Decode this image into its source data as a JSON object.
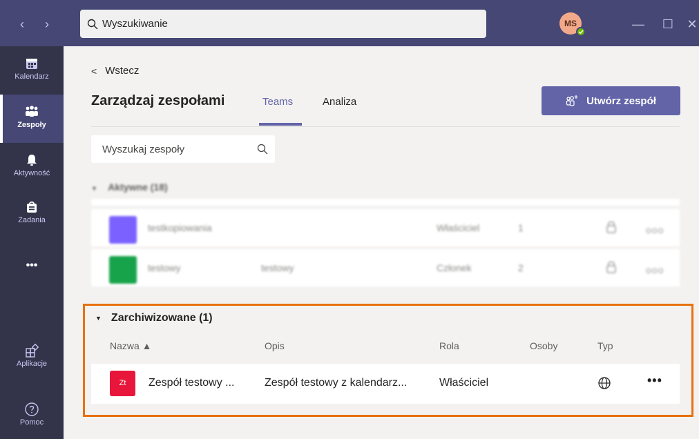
{
  "titlebar": {
    "back_arrow": "‹",
    "forward_arrow": "›",
    "search_placeholder": "Wyszukiwanie",
    "avatar_initials": "MS",
    "minimize": "—",
    "maximize": "☐",
    "close": "✕"
  },
  "rail": {
    "items": [
      {
        "label": "Kalendarz",
        "icon": "calendar-icon"
      },
      {
        "label": "Zespoły",
        "icon": "teams-icon",
        "active": true
      },
      {
        "label": "Aktywność",
        "icon": "bell-icon"
      },
      {
        "label": "Zadania",
        "icon": "bag-icon"
      },
      {
        "label": "•••",
        "icon": "more-icon"
      },
      {
        "label": "Aplikacje",
        "icon": "apps-icon"
      },
      {
        "label": "Pomoc",
        "icon": "help-icon"
      }
    ]
  },
  "main": {
    "back_label": "Wstecz",
    "title": "Zarządzaj zespołami",
    "tabs": [
      {
        "label": "Teams",
        "active": true
      },
      {
        "label": "Analiza",
        "active": false
      }
    ],
    "create_button": "Utwórz zespół",
    "team_search_placeholder": "Wyszukaj zespoły",
    "active_section": {
      "title": "Aktywne (18)",
      "rows": [
        {
          "tile_color": "#7b61ff",
          "name": "testkopiowania",
          "desc": "",
          "role": "Właściciel",
          "people": "1"
        },
        {
          "tile_color": "#16a34a",
          "name": "testowy",
          "desc": "testowy",
          "role": "Członek",
          "people": "2"
        }
      ],
      "more": "ooo"
    },
    "archived_section": {
      "title": "Zarchiwizowane (1)",
      "columns": {
        "name": "Nazwa ▲",
        "desc": "Opis",
        "role": "Rola",
        "people": "Osoby",
        "type": "Typ"
      },
      "rows": [
        {
          "tile": "Zt",
          "tile_color": "#e8163a",
          "name": "Zespół testowy ...",
          "desc": "Zespół testowy z kalendarz...",
          "role": "Właściciel",
          "people": "",
          "type_icon": "globe-icon",
          "more": "•••"
        }
      ]
    }
  },
  "colors": {
    "titlebar": "#464775",
    "rail": "#33344a",
    "accent": "#6264a7",
    "highlight": "#e8700d"
  }
}
